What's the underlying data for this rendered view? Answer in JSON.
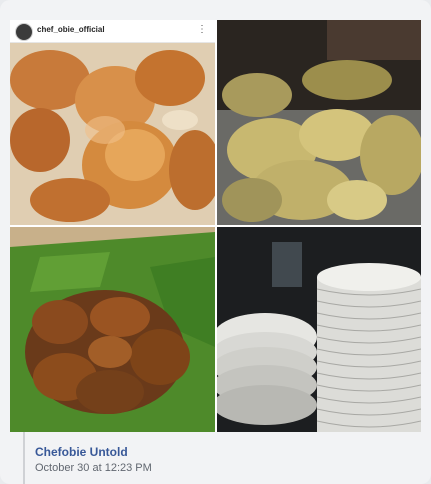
{
  "post": {
    "instagram_username": "chef_obie_official",
    "author_name": "Chefobie Untold",
    "timestamp": "October 30 at 12:23 PM"
  },
  "icons": {
    "more": "more-vertical-icon",
    "avatar": "avatar"
  },
  "colors": {
    "link_blue": "#385898",
    "meta_gray": "#616770",
    "card_bg": "#f2f3f5"
  }
}
